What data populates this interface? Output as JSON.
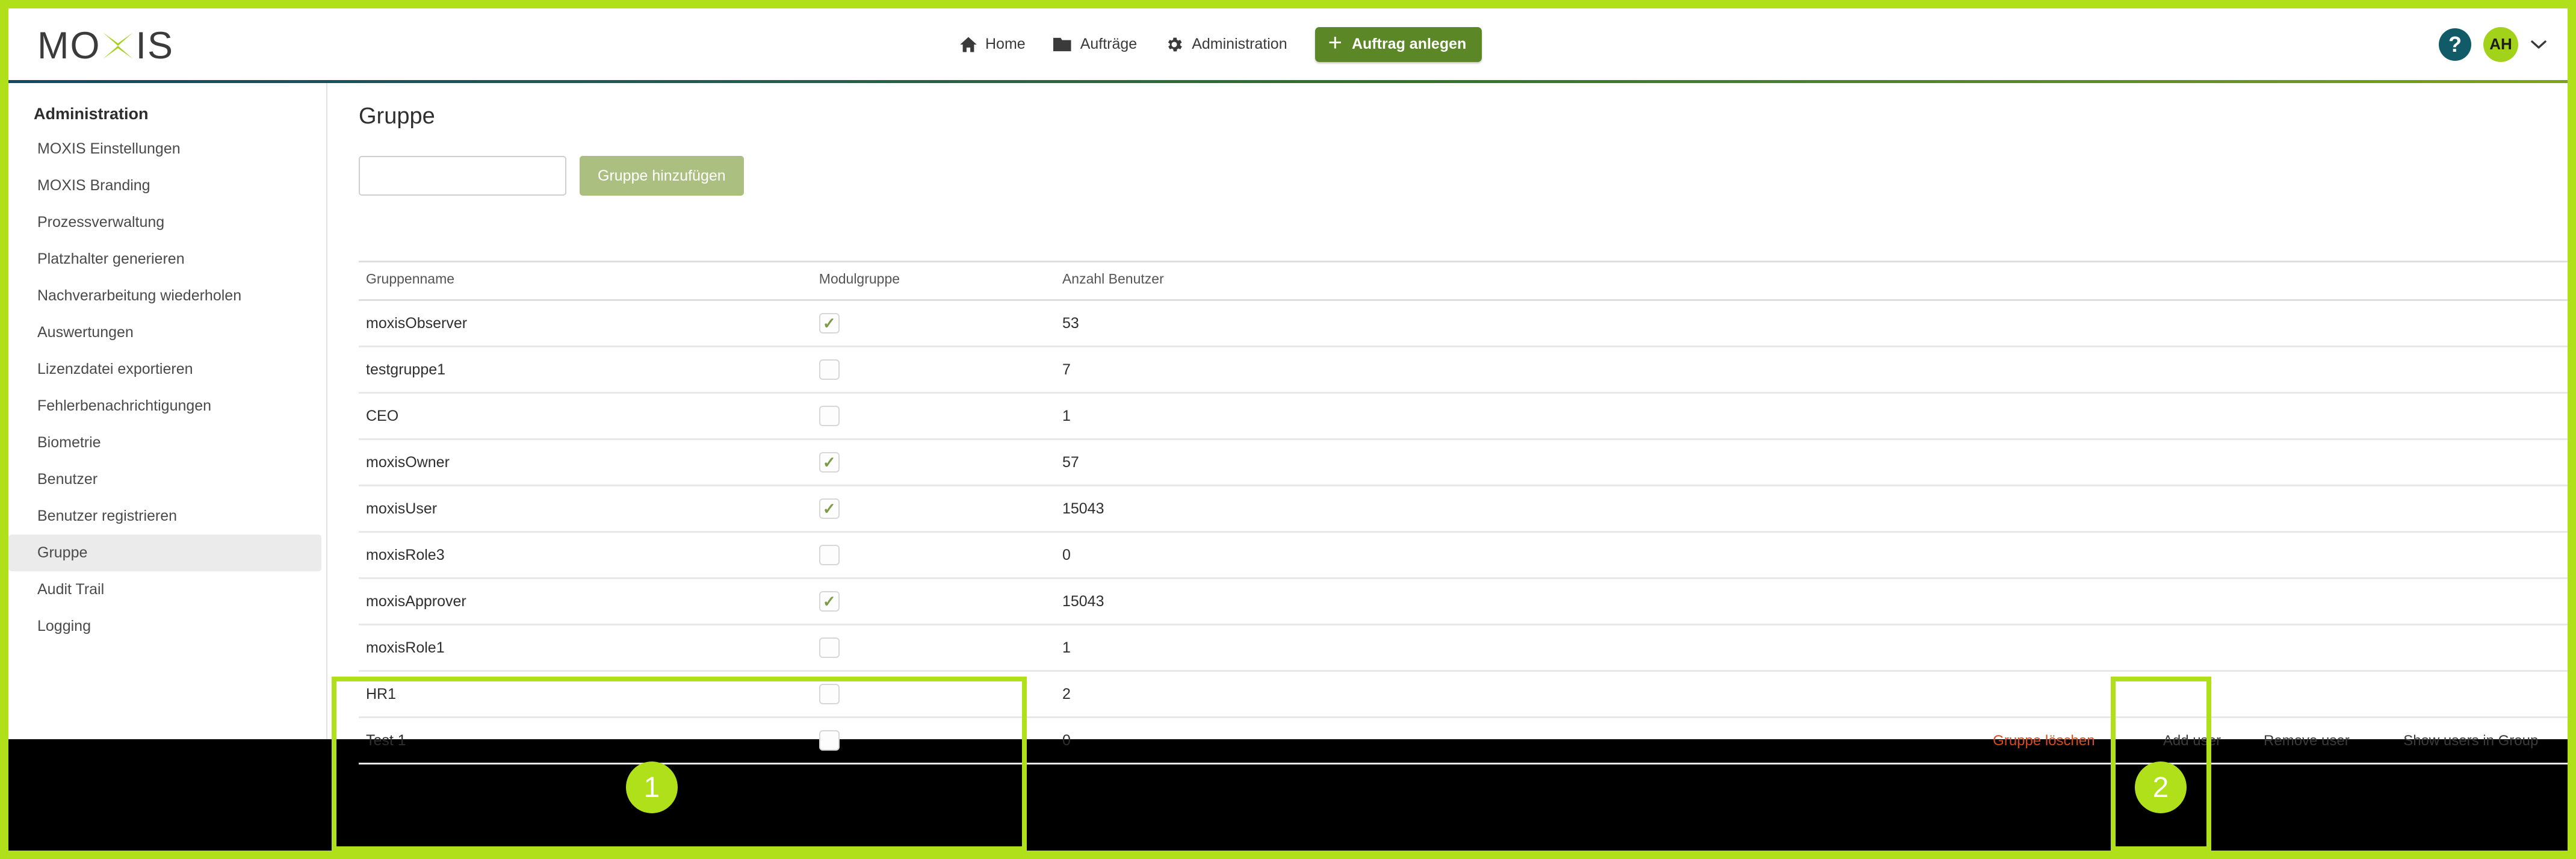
{
  "brand": {
    "logo_text_left": "MO",
    "logo_text_right": "IS",
    "logo_x_icon": "x-mark-icon",
    "accent_green": "#b0e019",
    "nav_green": "#5c8727",
    "danger_red": "#d94a1c"
  },
  "topnav": {
    "items": [
      {
        "label": "Home",
        "icon": "home-icon"
      },
      {
        "label": "Aufträge",
        "icon": "folder-icon"
      },
      {
        "label": "Administration",
        "icon": "gear-icon"
      }
    ],
    "create_button": {
      "label": "Auftrag anlegen",
      "icon": "plus-icon"
    },
    "help_icon": "question-mark-icon",
    "avatar_initials": "AH",
    "chevron_icon": "chevron-down-icon"
  },
  "sidebar": {
    "title": "Administration",
    "items": [
      {
        "label": "MOXIS Einstellungen",
        "active": false
      },
      {
        "label": "MOXIS Branding",
        "active": false
      },
      {
        "label": "Prozessverwaltung",
        "active": false
      },
      {
        "label": "Platzhalter generieren",
        "active": false
      },
      {
        "label": "Nachverarbeitung wiederholen",
        "active": false
      },
      {
        "label": "Auswertungen",
        "active": false
      },
      {
        "label": "Lizenzdatei exportieren",
        "active": false
      },
      {
        "label": "Fehlerbenachrichtigungen",
        "active": false
      },
      {
        "label": "Biometrie",
        "active": false
      },
      {
        "label": "Benutzer",
        "active": false
      },
      {
        "label": "Benutzer registrieren",
        "active": false
      },
      {
        "label": "Gruppe",
        "active": true
      },
      {
        "label": "Audit Trail",
        "active": false
      },
      {
        "label": "Logging",
        "active": false
      }
    ]
  },
  "main": {
    "page_title": "Gruppe",
    "new_group_input": {
      "value": "",
      "placeholder": ""
    },
    "add_group_button": "Gruppe hinzufügen",
    "table": {
      "columns": [
        "Gruppenname",
        "Modulgruppe",
        "Anzahl Benutzer"
      ],
      "rows": [
        {
          "name": "moxisObserver",
          "modulgruppe": true,
          "count": "53"
        },
        {
          "name": "testgruppe1",
          "modulgruppe": false,
          "count": "7"
        },
        {
          "name": "CEO",
          "modulgruppe": false,
          "count": "1"
        },
        {
          "name": "moxisOwner",
          "modulgruppe": true,
          "count": "57"
        },
        {
          "name": "moxisUser",
          "modulgruppe": true,
          "count": "15043"
        },
        {
          "name": "moxisRole3",
          "modulgruppe": false,
          "count": "0"
        },
        {
          "name": "moxisApprover",
          "modulgruppe": true,
          "count": "15043"
        },
        {
          "name": "moxisRole1",
          "modulgruppe": false,
          "count": "1"
        },
        {
          "name": "HR1",
          "modulgruppe": false,
          "count": "2"
        },
        {
          "name": "Test 1",
          "modulgruppe": false,
          "count": "0"
        }
      ],
      "row_actions": {
        "delete_group": "Gruppe löschen",
        "add_user": "Add user",
        "remove_user": "Remove user",
        "show_users": "Show users in Group"
      }
    }
  },
  "annotations": [
    {
      "number": "1",
      "target": "test-1-row"
    },
    {
      "number": "2",
      "target": "add-user-link"
    }
  ]
}
